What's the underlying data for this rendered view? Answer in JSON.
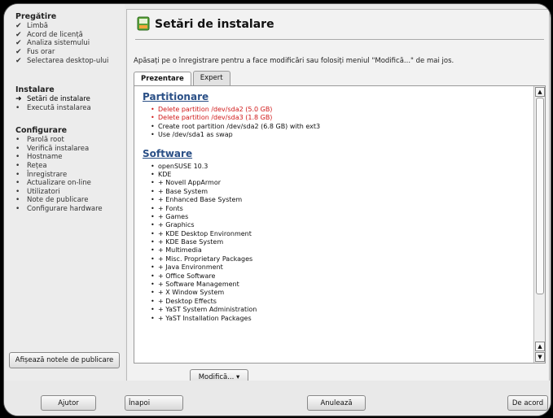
{
  "sidebar": {
    "sections": [
      {
        "title": "Pregătire",
        "items": [
          {
            "label": "Limbă",
            "mark": "✔"
          },
          {
            "label": "Acord de licență",
            "mark": "✔"
          },
          {
            "label": "Analiza sistemului",
            "mark": "✔"
          },
          {
            "label": "Fus orar",
            "mark": "✔"
          },
          {
            "label": "Selectarea desktop-ului",
            "mark": "✔"
          }
        ]
      },
      {
        "title": "Instalare",
        "items": [
          {
            "label": "Setări de instalare",
            "mark": "➜"
          },
          {
            "label": "Execută instalarea",
            "mark": "•"
          }
        ]
      },
      {
        "title": "Configurare",
        "items": [
          {
            "label": "Parolă root",
            "mark": "•"
          },
          {
            "label": "Verifică instalarea",
            "mark": "•"
          },
          {
            "label": "Hostname",
            "mark": "•"
          },
          {
            "label": "Rețea",
            "mark": "•"
          },
          {
            "label": "Înregistrare",
            "mark": "•"
          },
          {
            "label": "Actualizare on-line",
            "mark": "•"
          },
          {
            "label": "Utilizatori",
            "mark": "•"
          },
          {
            "label": "Note de publicare",
            "mark": "•"
          },
          {
            "label": "Configurare hardware",
            "mark": "•"
          }
        ]
      }
    ],
    "notes_button": "Afișează notele de publicare"
  },
  "main": {
    "title": "Setări de instalare",
    "instruction": "Apăsați pe o înregistrare pentru a face modificări sau folosiți meniul \"Modifică...\" de mai jos.",
    "tabs": [
      "Prezentare",
      "Expert"
    ],
    "partitioning": {
      "title": "Partitionare",
      "items": [
        {
          "text": "Delete partition /dev/sda2 (5.0 GB)",
          "color": "#d01818"
        },
        {
          "text": "Delete partition /dev/sda3 (1.8 GB)",
          "color": "#d01818"
        },
        {
          "text": "Create root partition /dev/sda2 (6.8 GB) with ext3",
          "color": "#111111"
        },
        {
          "text": "Use /dev/sda1 as swap",
          "color": "#111111"
        }
      ]
    },
    "software": {
      "title": "Software",
      "items": [
        "openSUSE 10.3",
        "KDE",
        "+ Novell AppArmor",
        "+ Base System",
        "+ Enhanced Base System",
        "+ Fonts",
        "+ Games",
        "+ Graphics",
        "+ KDE Desktop Environment",
        "+ KDE Base System",
        "+ Multimedia",
        "+ Misc. Proprietary Packages",
        "+ Java Environment",
        "+ Office Software",
        "+ Software Management",
        "+ X Window System",
        "+ Desktop Effects",
        "+ YaST System Administration",
        "+ YaST Installation Packages"
      ]
    },
    "modify_button": "Modifică... ▾"
  },
  "footer": {
    "help": "Ajutor",
    "back": "Înapoi",
    "abort": "Anulează",
    "accept": "De acord"
  },
  "colors": {
    "link_title": "#2a4f86",
    "delete_red": "#d01818"
  }
}
